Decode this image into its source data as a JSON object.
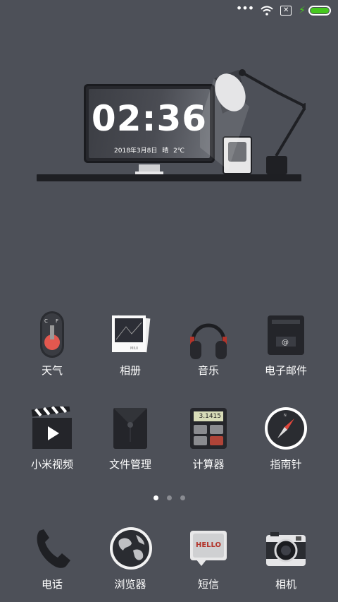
{
  "status": {
    "battery_color": "#46c81e"
  },
  "clock": {
    "time": "02:36",
    "date": "2018年3月8日  晴  2℃"
  },
  "apps": [
    {
      "label": "天气"
    },
    {
      "label": "相册"
    },
    {
      "label": "音乐"
    },
    {
      "label": "电子邮件"
    },
    {
      "label": "小米视频"
    },
    {
      "label": "文件管理"
    },
    {
      "label": "计算器"
    },
    {
      "label": "指南针"
    }
  ],
  "calculator": {
    "display": "3.1415"
  },
  "dock": [
    {
      "label": "电话"
    },
    {
      "label": "浏览器"
    },
    {
      "label": "短信"
    },
    {
      "label": "相机"
    }
  ],
  "messages_icon_text": "HELLO",
  "pager": {
    "pages": 3,
    "current": 1
  }
}
